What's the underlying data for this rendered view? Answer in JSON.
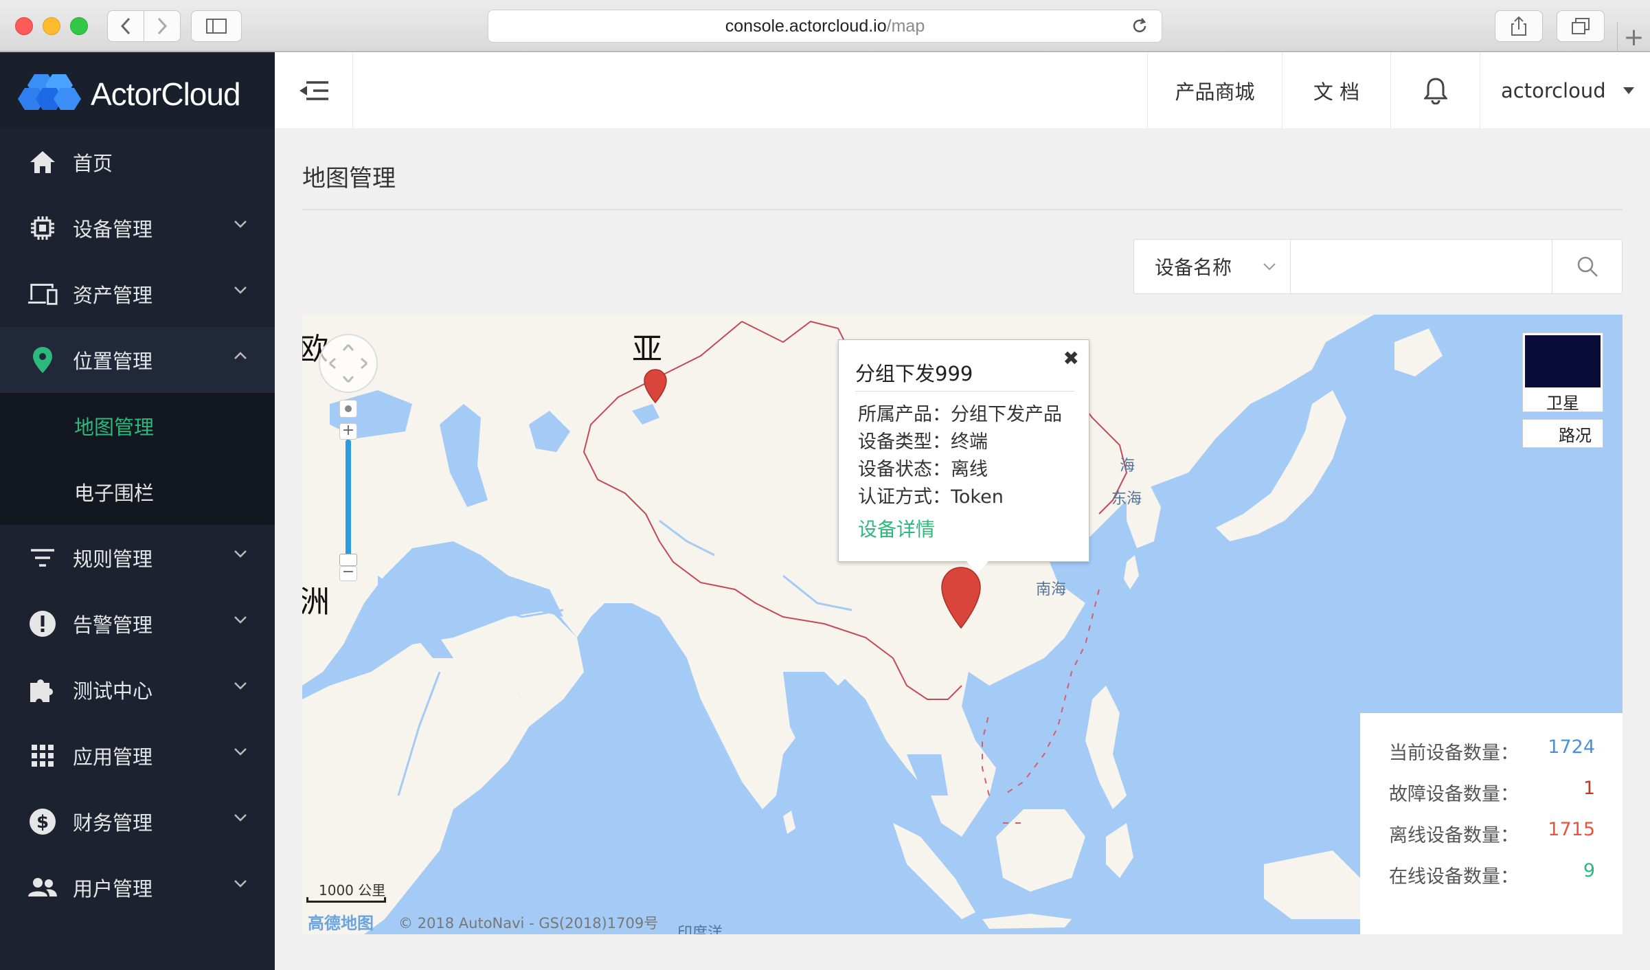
{
  "browser": {
    "url_host": "console.actorcloud.io",
    "url_path": "/map"
  },
  "sidebar": {
    "brand": "ActorCloud",
    "items": [
      {
        "label": "首页",
        "icon": "home-icon"
      },
      {
        "label": "设备管理",
        "icon": "chip-icon"
      },
      {
        "label": "资产管理",
        "icon": "devices-icon"
      },
      {
        "label": "位置管理",
        "icon": "location-pin-icon"
      },
      {
        "label": "规则管理",
        "icon": "filter-icon"
      },
      {
        "label": "告警管理",
        "icon": "alert-icon"
      },
      {
        "label": "测试中心",
        "icon": "puzzle-icon"
      },
      {
        "label": "应用管理",
        "icon": "grid-icon"
      },
      {
        "label": "财务管理",
        "icon": "dollar-icon"
      },
      {
        "label": "用户管理",
        "icon": "users-icon"
      }
    ],
    "subitems": [
      {
        "label": "地图管理",
        "active": true
      },
      {
        "label": "电子围栏",
        "active": false
      }
    ],
    "active_color": "#2db87d"
  },
  "header": {
    "store": "产品商城",
    "docs": "文 档",
    "user": "actorcloud"
  },
  "page": {
    "title": "地图管理"
  },
  "search": {
    "field": "设备名称",
    "value": ""
  },
  "map": {
    "labels": {
      "europe": "欧",
      "asia": "亚",
      "africa": "洲",
      "yellow_sea": "海",
      "east_china_sea": "东海",
      "south_china_sea": "南海",
      "indian_ocean": "印度洋"
    },
    "scale": "1000 公里",
    "copyright": "© 2018 AutoNavi - GS(2018)1709号",
    "provider": "高德地图",
    "layers": {
      "satellite": "卫星",
      "traffic": "路况"
    }
  },
  "popup": {
    "title": "分组下发999",
    "close": "✖",
    "rows": [
      "所属产品：分组下发产品",
      "设备类型：终端",
      "设备状态：离线",
      "认证方式：Token"
    ],
    "link": "设备详情"
  },
  "stats": [
    {
      "label": "当前设备数量：",
      "value": "1724",
      "color": "#4a90e2"
    },
    {
      "label": "故障设备数量：",
      "value": "1",
      "color": "#c0392b"
    },
    {
      "label": "离线设备数量：",
      "value": "1715",
      "color": "#e8553e"
    },
    {
      "label": "在线设备数量：",
      "value": "9",
      "color": "#2db87d"
    }
  ]
}
